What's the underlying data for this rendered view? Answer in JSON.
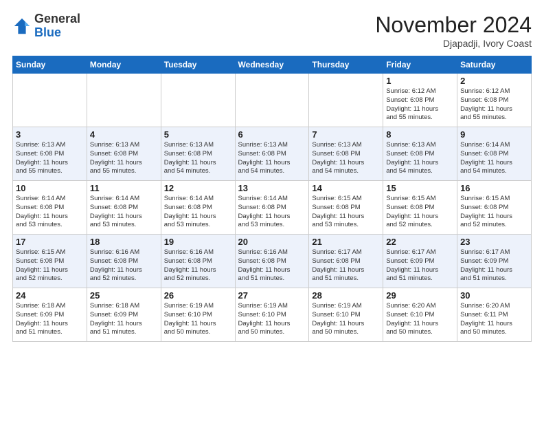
{
  "header": {
    "logo_general": "General",
    "logo_blue": "Blue",
    "month_title": "November 2024",
    "location": "Djapadji, Ivory Coast"
  },
  "weekdays": [
    "Sunday",
    "Monday",
    "Tuesday",
    "Wednesday",
    "Thursday",
    "Friday",
    "Saturday"
  ],
  "weeks": [
    [
      {
        "day": "",
        "info": ""
      },
      {
        "day": "",
        "info": ""
      },
      {
        "day": "",
        "info": ""
      },
      {
        "day": "",
        "info": ""
      },
      {
        "day": "",
        "info": ""
      },
      {
        "day": "1",
        "info": "Sunrise: 6:12 AM\nSunset: 6:08 PM\nDaylight: 11 hours\nand 55 minutes."
      },
      {
        "day": "2",
        "info": "Sunrise: 6:12 AM\nSunset: 6:08 PM\nDaylight: 11 hours\nand 55 minutes."
      }
    ],
    [
      {
        "day": "3",
        "info": "Sunrise: 6:13 AM\nSunset: 6:08 PM\nDaylight: 11 hours\nand 55 minutes."
      },
      {
        "day": "4",
        "info": "Sunrise: 6:13 AM\nSunset: 6:08 PM\nDaylight: 11 hours\nand 55 minutes."
      },
      {
        "day": "5",
        "info": "Sunrise: 6:13 AM\nSunset: 6:08 PM\nDaylight: 11 hours\nand 54 minutes."
      },
      {
        "day": "6",
        "info": "Sunrise: 6:13 AM\nSunset: 6:08 PM\nDaylight: 11 hours\nand 54 minutes."
      },
      {
        "day": "7",
        "info": "Sunrise: 6:13 AM\nSunset: 6:08 PM\nDaylight: 11 hours\nand 54 minutes."
      },
      {
        "day": "8",
        "info": "Sunrise: 6:13 AM\nSunset: 6:08 PM\nDaylight: 11 hours\nand 54 minutes."
      },
      {
        "day": "9",
        "info": "Sunrise: 6:14 AM\nSunset: 6:08 PM\nDaylight: 11 hours\nand 54 minutes."
      }
    ],
    [
      {
        "day": "10",
        "info": "Sunrise: 6:14 AM\nSunset: 6:08 PM\nDaylight: 11 hours\nand 53 minutes."
      },
      {
        "day": "11",
        "info": "Sunrise: 6:14 AM\nSunset: 6:08 PM\nDaylight: 11 hours\nand 53 minutes."
      },
      {
        "day": "12",
        "info": "Sunrise: 6:14 AM\nSunset: 6:08 PM\nDaylight: 11 hours\nand 53 minutes."
      },
      {
        "day": "13",
        "info": "Sunrise: 6:14 AM\nSunset: 6:08 PM\nDaylight: 11 hours\nand 53 minutes."
      },
      {
        "day": "14",
        "info": "Sunrise: 6:15 AM\nSunset: 6:08 PM\nDaylight: 11 hours\nand 53 minutes."
      },
      {
        "day": "15",
        "info": "Sunrise: 6:15 AM\nSunset: 6:08 PM\nDaylight: 11 hours\nand 52 minutes."
      },
      {
        "day": "16",
        "info": "Sunrise: 6:15 AM\nSunset: 6:08 PM\nDaylight: 11 hours\nand 52 minutes."
      }
    ],
    [
      {
        "day": "17",
        "info": "Sunrise: 6:15 AM\nSunset: 6:08 PM\nDaylight: 11 hours\nand 52 minutes."
      },
      {
        "day": "18",
        "info": "Sunrise: 6:16 AM\nSunset: 6:08 PM\nDaylight: 11 hours\nand 52 minutes."
      },
      {
        "day": "19",
        "info": "Sunrise: 6:16 AM\nSunset: 6:08 PM\nDaylight: 11 hours\nand 52 minutes."
      },
      {
        "day": "20",
        "info": "Sunrise: 6:16 AM\nSunset: 6:08 PM\nDaylight: 11 hours\nand 51 minutes."
      },
      {
        "day": "21",
        "info": "Sunrise: 6:17 AM\nSunset: 6:08 PM\nDaylight: 11 hours\nand 51 minutes."
      },
      {
        "day": "22",
        "info": "Sunrise: 6:17 AM\nSunset: 6:09 PM\nDaylight: 11 hours\nand 51 minutes."
      },
      {
        "day": "23",
        "info": "Sunrise: 6:17 AM\nSunset: 6:09 PM\nDaylight: 11 hours\nand 51 minutes."
      }
    ],
    [
      {
        "day": "24",
        "info": "Sunrise: 6:18 AM\nSunset: 6:09 PM\nDaylight: 11 hours\nand 51 minutes."
      },
      {
        "day": "25",
        "info": "Sunrise: 6:18 AM\nSunset: 6:09 PM\nDaylight: 11 hours\nand 51 minutes."
      },
      {
        "day": "26",
        "info": "Sunrise: 6:19 AM\nSunset: 6:10 PM\nDaylight: 11 hours\nand 50 minutes."
      },
      {
        "day": "27",
        "info": "Sunrise: 6:19 AM\nSunset: 6:10 PM\nDaylight: 11 hours\nand 50 minutes."
      },
      {
        "day": "28",
        "info": "Sunrise: 6:19 AM\nSunset: 6:10 PM\nDaylight: 11 hours\nand 50 minutes."
      },
      {
        "day": "29",
        "info": "Sunrise: 6:20 AM\nSunset: 6:10 PM\nDaylight: 11 hours\nand 50 minutes."
      },
      {
        "day": "30",
        "info": "Sunrise: 6:20 AM\nSunset: 6:11 PM\nDaylight: 11 hours\nand 50 minutes."
      }
    ]
  ]
}
